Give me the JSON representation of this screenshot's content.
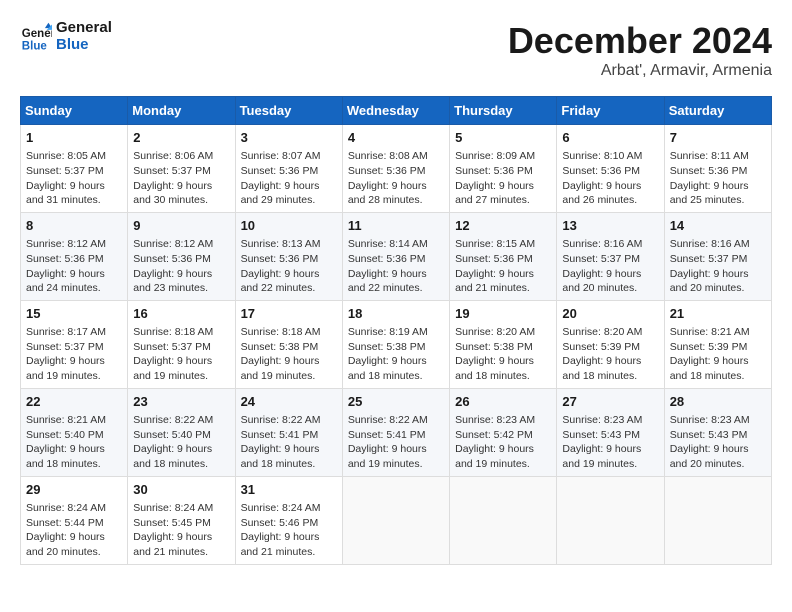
{
  "header": {
    "logo_line1": "General",
    "logo_line2": "Blue",
    "month_title": "December 2024",
    "location": "Arbat', Armavir, Armenia"
  },
  "days_of_week": [
    "Sunday",
    "Monday",
    "Tuesday",
    "Wednesday",
    "Thursday",
    "Friday",
    "Saturday"
  ],
  "weeks": [
    [
      {
        "day": "1",
        "sunrise": "8:05 AM",
        "sunset": "5:37 PM",
        "daylight": "9 hours and 31 minutes."
      },
      {
        "day": "2",
        "sunrise": "8:06 AM",
        "sunset": "5:37 PM",
        "daylight": "9 hours and 30 minutes."
      },
      {
        "day": "3",
        "sunrise": "8:07 AM",
        "sunset": "5:36 PM",
        "daylight": "9 hours and 29 minutes."
      },
      {
        "day": "4",
        "sunrise": "8:08 AM",
        "sunset": "5:36 PM",
        "daylight": "9 hours and 28 minutes."
      },
      {
        "day": "5",
        "sunrise": "8:09 AM",
        "sunset": "5:36 PM",
        "daylight": "9 hours and 27 minutes."
      },
      {
        "day": "6",
        "sunrise": "8:10 AM",
        "sunset": "5:36 PM",
        "daylight": "9 hours and 26 minutes."
      },
      {
        "day": "7",
        "sunrise": "8:11 AM",
        "sunset": "5:36 PM",
        "daylight": "9 hours and 25 minutes."
      }
    ],
    [
      {
        "day": "8",
        "sunrise": "8:12 AM",
        "sunset": "5:36 PM",
        "daylight": "9 hours and 24 minutes."
      },
      {
        "day": "9",
        "sunrise": "8:12 AM",
        "sunset": "5:36 PM",
        "daylight": "9 hours and 23 minutes."
      },
      {
        "day": "10",
        "sunrise": "8:13 AM",
        "sunset": "5:36 PM",
        "daylight": "9 hours and 22 minutes."
      },
      {
        "day": "11",
        "sunrise": "8:14 AM",
        "sunset": "5:36 PM",
        "daylight": "9 hours and 22 minutes."
      },
      {
        "day": "12",
        "sunrise": "8:15 AM",
        "sunset": "5:36 PM",
        "daylight": "9 hours and 21 minutes."
      },
      {
        "day": "13",
        "sunrise": "8:16 AM",
        "sunset": "5:37 PM",
        "daylight": "9 hours and 20 minutes."
      },
      {
        "day": "14",
        "sunrise": "8:16 AM",
        "sunset": "5:37 PM",
        "daylight": "9 hours and 20 minutes."
      }
    ],
    [
      {
        "day": "15",
        "sunrise": "8:17 AM",
        "sunset": "5:37 PM",
        "daylight": "9 hours and 19 minutes."
      },
      {
        "day": "16",
        "sunrise": "8:18 AM",
        "sunset": "5:37 PM",
        "daylight": "9 hours and 19 minutes."
      },
      {
        "day": "17",
        "sunrise": "8:18 AM",
        "sunset": "5:38 PM",
        "daylight": "9 hours and 19 minutes."
      },
      {
        "day": "18",
        "sunrise": "8:19 AM",
        "sunset": "5:38 PM",
        "daylight": "9 hours and 18 minutes."
      },
      {
        "day": "19",
        "sunrise": "8:20 AM",
        "sunset": "5:38 PM",
        "daylight": "9 hours and 18 minutes."
      },
      {
        "day": "20",
        "sunrise": "8:20 AM",
        "sunset": "5:39 PM",
        "daylight": "9 hours and 18 minutes."
      },
      {
        "day": "21",
        "sunrise": "8:21 AM",
        "sunset": "5:39 PM",
        "daylight": "9 hours and 18 minutes."
      }
    ],
    [
      {
        "day": "22",
        "sunrise": "8:21 AM",
        "sunset": "5:40 PM",
        "daylight": "9 hours and 18 minutes."
      },
      {
        "day": "23",
        "sunrise": "8:22 AM",
        "sunset": "5:40 PM",
        "daylight": "9 hours and 18 minutes."
      },
      {
        "day": "24",
        "sunrise": "8:22 AM",
        "sunset": "5:41 PM",
        "daylight": "9 hours and 18 minutes."
      },
      {
        "day": "25",
        "sunrise": "8:22 AM",
        "sunset": "5:41 PM",
        "daylight": "9 hours and 19 minutes."
      },
      {
        "day": "26",
        "sunrise": "8:23 AM",
        "sunset": "5:42 PM",
        "daylight": "9 hours and 19 minutes."
      },
      {
        "day": "27",
        "sunrise": "8:23 AM",
        "sunset": "5:43 PM",
        "daylight": "9 hours and 19 minutes."
      },
      {
        "day": "28",
        "sunrise": "8:23 AM",
        "sunset": "5:43 PM",
        "daylight": "9 hours and 20 minutes."
      }
    ],
    [
      {
        "day": "29",
        "sunrise": "8:24 AM",
        "sunset": "5:44 PM",
        "daylight": "9 hours and 20 minutes."
      },
      {
        "day": "30",
        "sunrise": "8:24 AM",
        "sunset": "5:45 PM",
        "daylight": "9 hours and 21 minutes."
      },
      {
        "day": "31",
        "sunrise": "8:24 AM",
        "sunset": "5:46 PM",
        "daylight": "9 hours and 21 minutes."
      },
      null,
      null,
      null,
      null
    ]
  ],
  "labels": {
    "sunrise": "Sunrise:",
    "sunset": "Sunset:",
    "daylight": "Daylight:"
  }
}
